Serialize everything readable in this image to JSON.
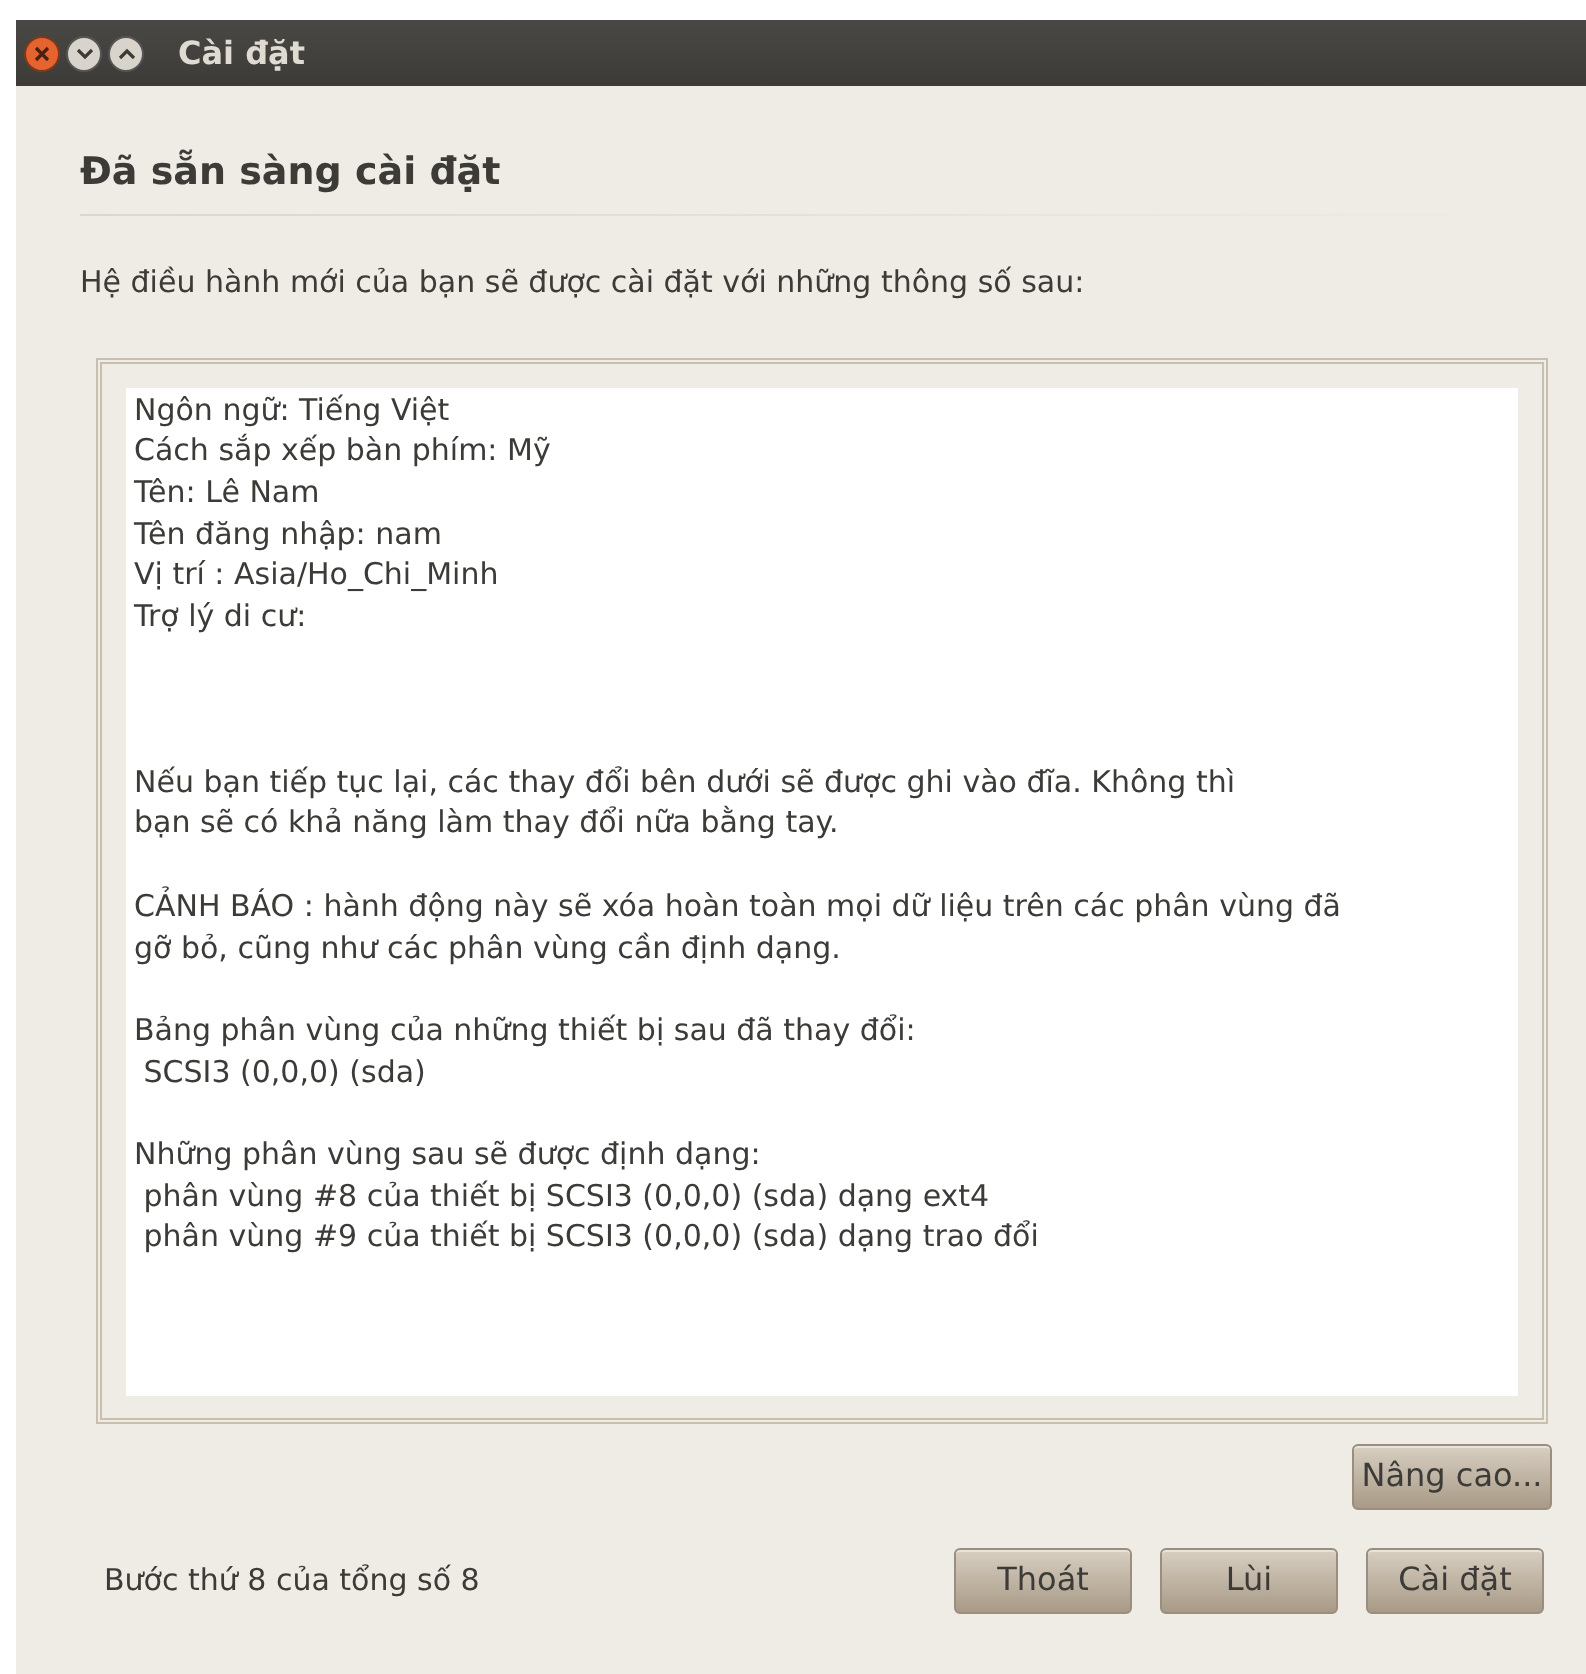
{
  "window": {
    "title": "Cài đặt"
  },
  "heading": "Đã sẵn sàng cài đặt",
  "intro": "Hệ điều hành mới của bạn sẽ được cài đặt với những thông số sau:",
  "summary": [
    {
      "lines": [
        "Ngôn ngữ: Tiếng Việt",
        "Cách sắp xếp bàn phím: Mỹ",
        "Tên: Lê Nam",
        "Tên đăng nhập: nam",
        "Vị trí : Asia/Ho_Chi_Minh",
        "Trợ lý di cư:"
      ]
    },
    {
      "lines": [
        "Nếu bạn tiếp tục lại, các thay đổi bên dưới sẽ được ghi vào đĩa. Không thì",
        "bạn sẽ có khả năng làm thay đổi nữa bằng tay."
      ]
    },
    {
      "lines": [
        "CẢNH BÁO : hành động này sẽ xóa hoàn toàn mọi dữ liệu trên các phân vùng đã",
        "gỡ bỏ, cũng như các phân vùng cần định dạng."
      ]
    },
    {
      "lines": [
        "Bảng phân vùng của những thiết bị sau đã thay đổi:",
        " SCSI3 (0,0,0) (sda)"
      ]
    },
    {
      "lines": [
        "Những phân vùng sau sẽ được định dạng:",
        " phân vùng #8 của thiết bị SCSI3 (0,0,0) (sda) dạng ext4",
        " phân vùng #9 của thiết bị SCSI3 (0,0,0) (sda) dạng trao đổi"
      ]
    }
  ],
  "advanced_button": "Nâng cao...",
  "step": "Bước thứ 8 của tổng số 8",
  "buttons": [
    "Thoát",
    "Lùi",
    "Cài đặt"
  ]
}
